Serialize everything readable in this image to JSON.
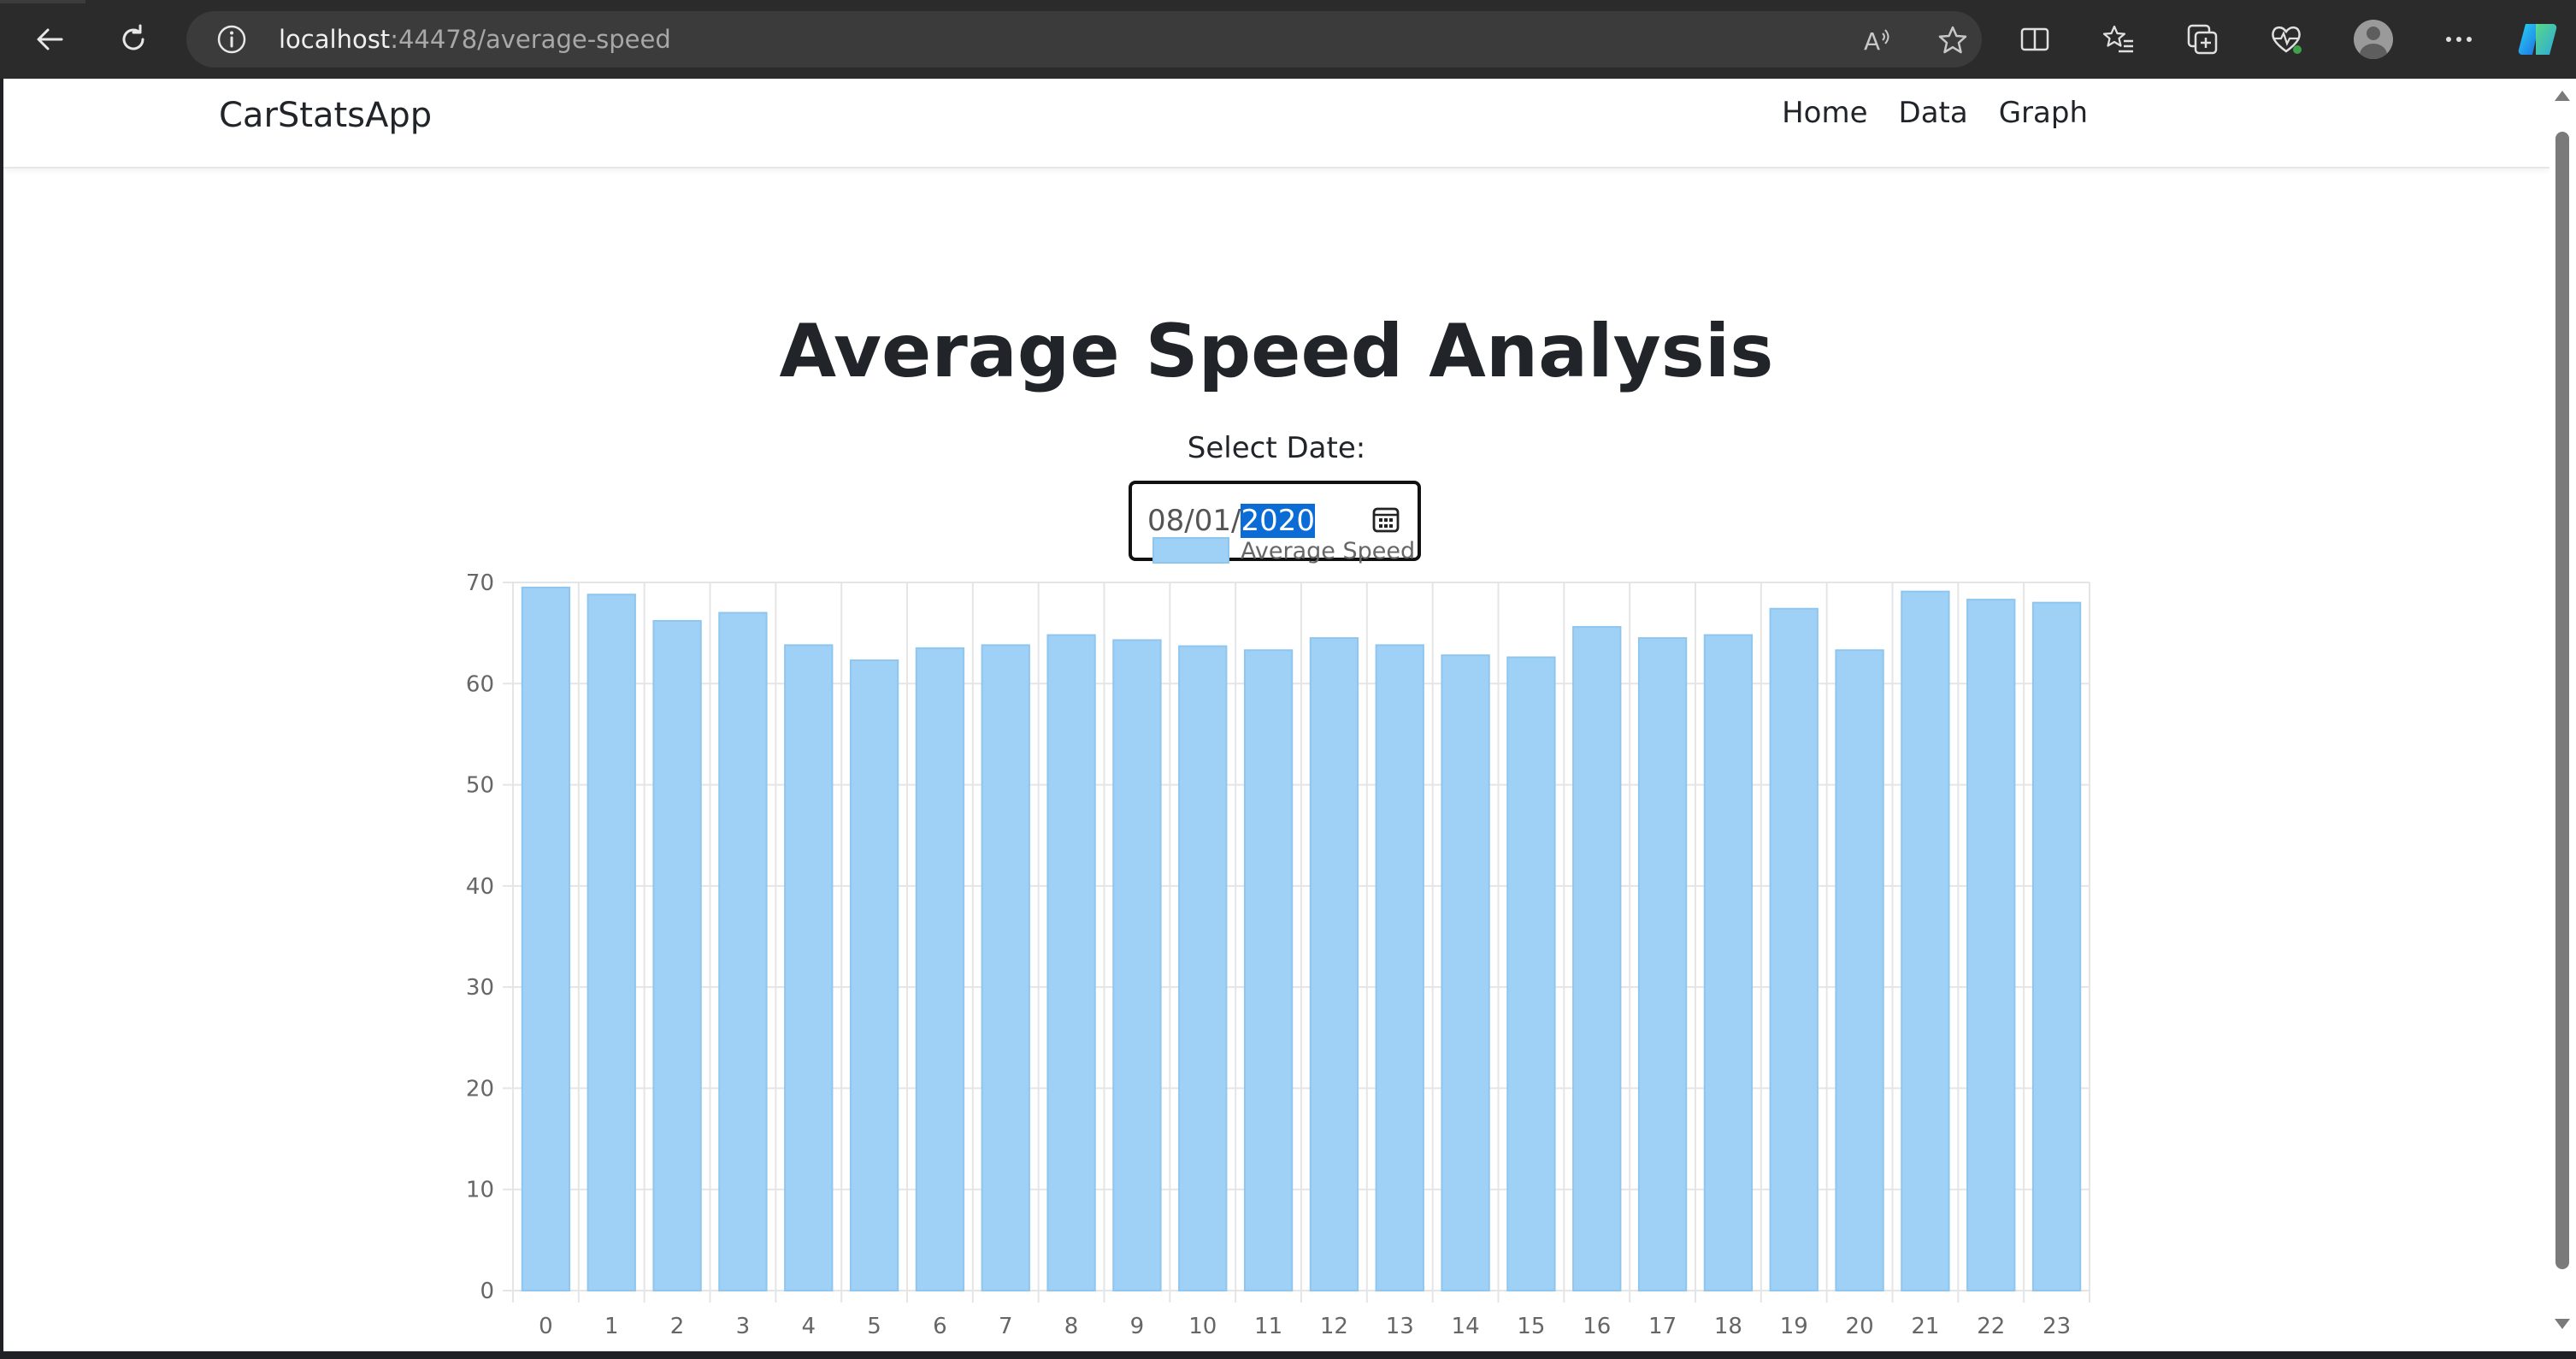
{
  "browser": {
    "url_host": "localhost",
    "url_path": ":44478/average-speed"
  },
  "app": {
    "brand": "CarStatsApp",
    "nav": [
      "Home",
      "Data",
      "Graph"
    ]
  },
  "page": {
    "title": "Average Speed Analysis",
    "date_label": "Select Date:",
    "date_value_prefix": "08/01/",
    "date_value_selected": "2020"
  },
  "chart_data": {
    "type": "bar",
    "categories": [
      "0",
      "1",
      "2",
      "3",
      "4",
      "5",
      "6",
      "7",
      "8",
      "9",
      "10",
      "11",
      "12",
      "13",
      "14",
      "15",
      "16",
      "17",
      "18",
      "19",
      "20",
      "21",
      "22",
      "23"
    ],
    "series": [
      {
        "name": "Average Speed",
        "values": [
          69.5,
          68.8,
          66.2,
          67.0,
          63.8,
          62.3,
          63.5,
          63.8,
          64.8,
          64.3,
          63.7,
          63.3,
          64.5,
          63.8,
          62.8,
          62.6,
          65.6,
          64.5,
          64.8,
          67.4,
          63.3,
          69.1,
          68.3,
          68.0
        ]
      }
    ],
    "ylim": [
      0,
      70
    ],
    "yticks": [
      0,
      10,
      20,
      30,
      40,
      50,
      60,
      70
    ],
    "legend_position": "top",
    "grid": true,
    "colors": {
      "bar_fill": "#9fd0f5",
      "bar_stroke": "#8fc6ef",
      "grid": "#e5e5e5"
    }
  }
}
